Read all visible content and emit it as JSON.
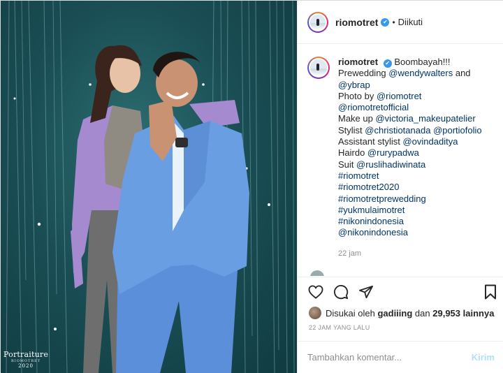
{
  "photo": {
    "watermark_main": "Portraiture",
    "watermark_sub": "RIOMOTRET",
    "watermark_year": "2020"
  },
  "header": {
    "username": "riomotret",
    "verified_icon": "✔",
    "separator": "•",
    "follow_status": "Diikuti"
  },
  "caption": {
    "username": "riomotret",
    "verified_icon": "✔",
    "lines": [
      {
        "pre": "Boombayah!!!",
        "links": []
      },
      {
        "pre": "Prewedding ",
        "link1": "@wendywalters",
        "mid": " and"
      },
      {
        "link1": "@ybrap"
      },
      {
        "pre": "Photo by ",
        "link1": "@riomotret"
      },
      {
        "link1": "@riomotretofficial"
      },
      {
        "pre": "Make up ",
        "link1": "@victoria_makeupatelier"
      },
      {
        "pre": "Stylist ",
        "link1": "@christiotanada",
        "mid": " ",
        "link2": "@portiofolio"
      },
      {
        "pre": "Assistant stylist ",
        "link1": "@ovindaditya"
      },
      {
        "pre": "Hairdo ",
        "link1": "@rurypadwa"
      },
      {
        "pre": "Suit ",
        "link1": "@ruslihadiwinata"
      },
      {
        "link1": "#riomotret"
      },
      {
        "link1": "#riomotret2020"
      },
      {
        "link1": "#riomotretprewedding"
      },
      {
        "link1": "#yukmulaimotret"
      },
      {
        "link1": "#nikonindonesia"
      },
      {
        "link1": "@nikonindonesia"
      }
    ],
    "time": "22 jam"
  },
  "likes": {
    "prefix": "Disukai oleh",
    "user": "gadiiing",
    "mid": "dan",
    "count": "29,953 lainnya"
  },
  "timestamp": "22 JAM YANG LALU",
  "comment": {
    "placeholder": "Tambahkan komentar...",
    "post_label": "Kirim"
  },
  "colors": {
    "link": "#003569",
    "verified": "#3897f0",
    "post_disabled": "#b2dffc",
    "muted": "#8e8e8e"
  }
}
